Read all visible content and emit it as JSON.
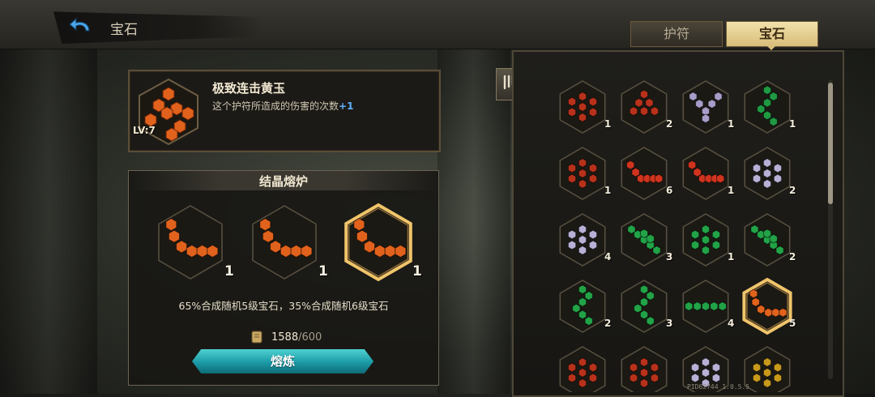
{
  "header": {
    "title": "宝石",
    "tabs": [
      {
        "label": "护符",
        "active": false
      },
      {
        "label": "宝石",
        "active": true
      }
    ]
  },
  "selected_gem": {
    "name": "极致连击黄玉",
    "description": "这个护符所造成的伤害的次数",
    "bonus": "+1",
    "level": "LV:7",
    "color": "#e1621c",
    "icon": "orange-gem-cluster"
  },
  "furnace": {
    "title": "结晶熔炉",
    "slots": [
      {
        "count": "1",
        "color": "#e1621c",
        "pattern": "l-chain"
      },
      {
        "count": "1",
        "color": "#e1621c",
        "pattern": "l-chain"
      },
      {
        "count": "1",
        "color": "#e1621c",
        "pattern": "l-chain",
        "highlighted": true
      }
    ],
    "rate_text": "65%合成随机5级宝石，35%合成随机6级宝石",
    "cost_have": "1588",
    "cost_need": "/600",
    "smelt_label": "熔炼"
  },
  "inventory": {
    "gems": [
      {
        "color": "#b8321b",
        "pattern": "cluster",
        "count": "1"
      },
      {
        "color": "#b8321b",
        "pattern": "triangle",
        "count": "2"
      },
      {
        "color": "#a89cc8",
        "pattern": "v-shape",
        "count": "1"
      },
      {
        "color": "#1f9a42",
        "pattern": "zigzag",
        "count": "1"
      },
      {
        "color": "#b8321b",
        "pattern": "cluster",
        "count": "1"
      },
      {
        "color": "#d0341e",
        "pattern": "hook",
        "count": "6"
      },
      {
        "color": "#d0341e",
        "pattern": "hook",
        "count": "1"
      },
      {
        "color": "#b9b0d6",
        "pattern": "cluster",
        "count": "2"
      },
      {
        "color": "#b9b0d6",
        "pattern": "cluster",
        "count": "4"
      },
      {
        "color": "#22a347",
        "pattern": "diagonal",
        "count": "3"
      },
      {
        "color": "#22a347",
        "pattern": "cluster",
        "count": "1"
      },
      {
        "color": "#22a347",
        "pattern": "diagonal",
        "count": "2"
      },
      {
        "color": "#22a347",
        "pattern": "zigzag",
        "count": "2"
      },
      {
        "color": "#22a347",
        "pattern": "zigzag",
        "count": "3"
      },
      {
        "color": "#22a347",
        "pattern": "line",
        "count": "4"
      },
      {
        "color": "#e1621c",
        "pattern": "l-chain",
        "count": "5",
        "selected": true
      },
      {
        "color": "#b8321b",
        "pattern": "cluster",
        "count": ""
      },
      {
        "color": "#b8321b",
        "pattern": "cluster",
        "count": ""
      },
      {
        "color": "#b9b0d6",
        "pattern": "cluster",
        "count": ""
      },
      {
        "color": "#c79a1c",
        "pattern": "cluster",
        "count": ""
      }
    ]
  },
  "version": "PID62744  1.0.5.5"
}
